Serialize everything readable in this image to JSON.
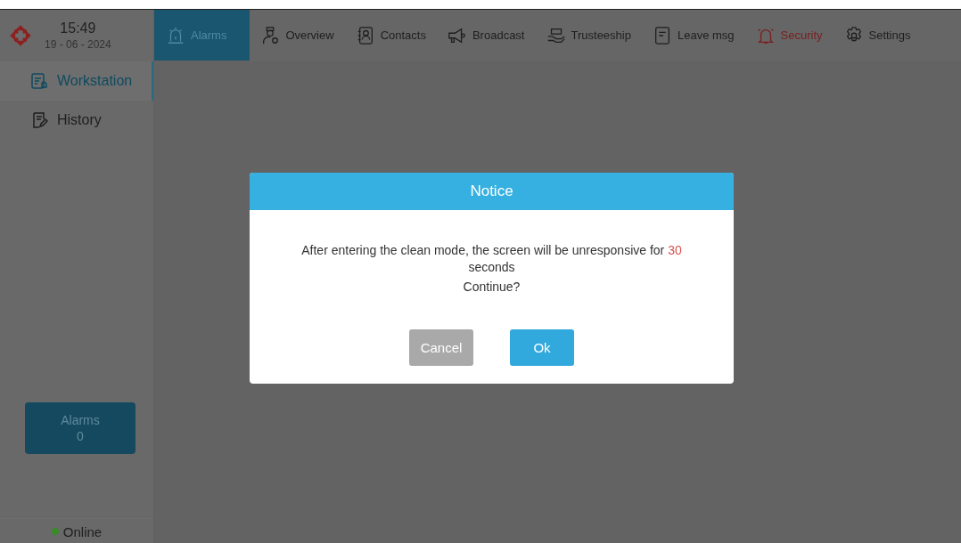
{
  "header": {
    "time": "15:49",
    "date": "19 - 06 - 2024"
  },
  "nav": [
    {
      "label": "Alarms",
      "selected": true,
      "alert": false
    },
    {
      "label": "Overview",
      "selected": false,
      "alert": false
    },
    {
      "label": "Contacts",
      "selected": false,
      "alert": false
    },
    {
      "label": "Broadcast",
      "selected": false,
      "alert": false
    },
    {
      "label": "Trusteeship",
      "selected": false,
      "alert": false
    },
    {
      "label": "Leave msg",
      "selected": false,
      "alert": false
    },
    {
      "label": "Security",
      "selected": false,
      "alert": true
    },
    {
      "label": "Settings",
      "selected": false,
      "alert": false
    }
  ],
  "sidebar": {
    "items": [
      {
        "label": "Workstation",
        "selected": true
      },
      {
        "label": "History",
        "selected": false
      }
    ],
    "alarm_card": {
      "label": "Alarms",
      "count": "0"
    },
    "status": {
      "label": "Online",
      "online": true
    }
  },
  "dialog": {
    "title": "Notice",
    "message": {
      "before": "After entering the clean mode, the screen will be unresponsive for ",
      "highlight": "30",
      "after": " seconds"
    },
    "question": "Continue?",
    "buttons": [
      {
        "label": "Cancel",
        "disabled": true
      },
      {
        "label": "Ok",
        "disabled": false
      }
    ]
  }
}
